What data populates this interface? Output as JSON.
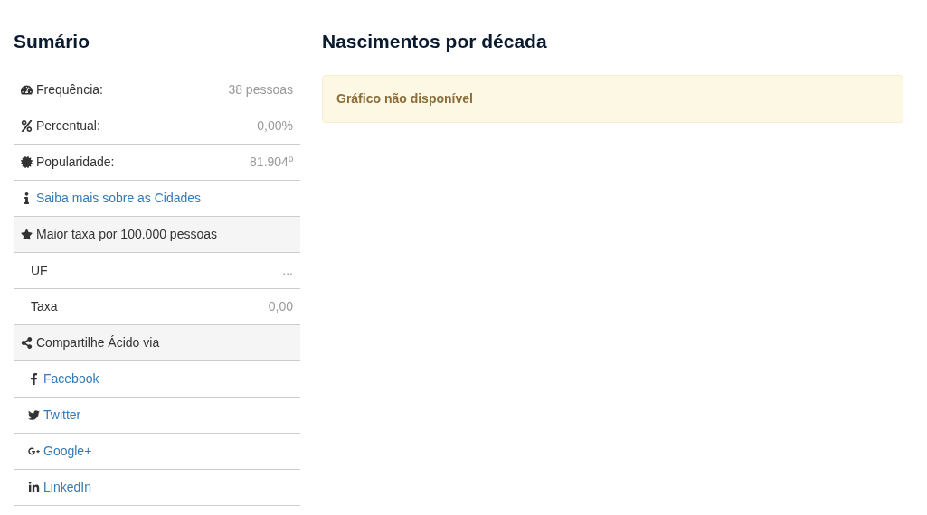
{
  "summary": {
    "title": "Sumário",
    "rows": [
      {
        "kind": "stat",
        "label": "Frequência:",
        "value": "38 pessoas"
      },
      {
        "kind": "stat",
        "label": "Percentual:",
        "value": "0,00%"
      },
      {
        "kind": "stat",
        "label": "Popularidade:",
        "value": "81.904º"
      },
      {
        "kind": "link",
        "label": "Saiba mais sobre as Cidades"
      },
      {
        "kind": "header",
        "label": "Maior taxa por 100.000 pessoas"
      },
      {
        "kind": "sub",
        "label": "UF",
        "value": "..."
      },
      {
        "kind": "sub",
        "label": "Taxa",
        "value": "0,00"
      },
      {
        "kind": "header",
        "label": "Compartilhe Ácido via"
      },
      {
        "kind": "share",
        "label": "Facebook"
      },
      {
        "kind": "share",
        "label": "Twitter"
      },
      {
        "kind": "share",
        "label": "Google+"
      },
      {
        "kind": "share",
        "label": "LinkedIn"
      }
    ]
  },
  "births": {
    "title": "Nascimentos por década",
    "alert": "Gráfico não disponível"
  }
}
